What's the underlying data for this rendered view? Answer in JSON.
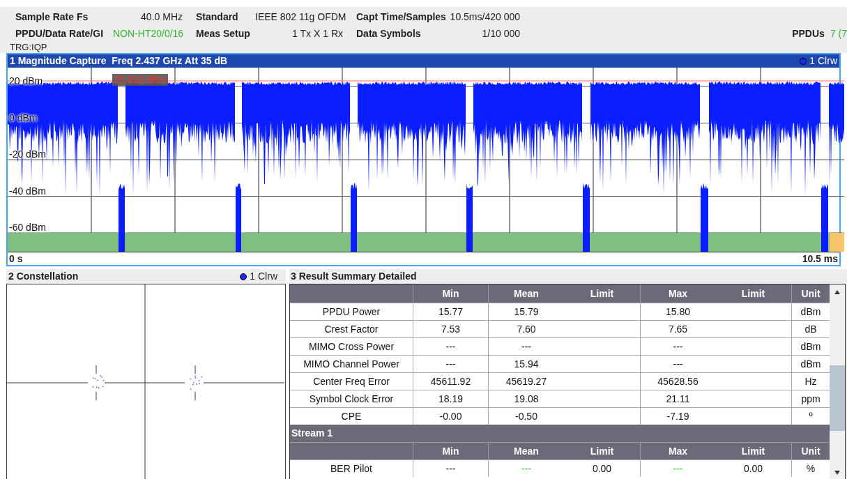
{
  "header": {
    "rows": [
      [
        {
          "label": "Sample Rate Fs",
          "value": "40.0 MHz",
          "highlight": false
        },
        {
          "label": "Standard",
          "value": "IEEE 802 11g OFDM",
          "highlight": false
        },
        {
          "label": "Capt Time/Samples",
          "value": "10.5ms/420 000",
          "highlight": false
        }
      ],
      [
        {
          "label": "PPDU/Data Rate/GI",
          "value": "NON-HT20/0/16",
          "highlight": true
        },
        {
          "label": "Meas Setup",
          "value": "1 Tx X 1 Rx",
          "highlight": false
        },
        {
          "label": "Data Symbols",
          "value": "1/10 000",
          "highlight": false
        }
      ]
    ],
    "ppdus": {
      "label": "PPDUs",
      "value": "7 (7",
      "highlight": true
    },
    "trigger": "TRG:IQP"
  },
  "magnitude": {
    "title": "1 Magnitude Capture  Freq 2.437 GHz Att 35 dB",
    "trace": "1 Clrw",
    "marker": "23.310 dBm",
    "y_labels": [
      "20 dBm",
      "0 dBm",
      "-20 dBm",
      "-40 dBm",
      "-60 dBm"
    ],
    "x_start": "0 s",
    "x_end": "10.5 ms"
  },
  "constellation": {
    "title": "2 Constellation",
    "trace": "1 Clrw"
  },
  "summary": {
    "title": "3 Result Summary Detailed",
    "columns": [
      "",
      "Min",
      "Mean",
      "Limit",
      "Max",
      "Limit",
      "Unit"
    ],
    "rows": [
      {
        "kind": "data",
        "cells": [
          "PPDU Power",
          "15.77",
          "15.79",
          "",
          "15.80",
          "",
          "dBm"
        ],
        "pass": false
      },
      {
        "kind": "data",
        "cells": [
          "Crest Factor",
          "7.53",
          "7.60",
          "",
          "7.65",
          "",
          "dB"
        ],
        "pass": false
      },
      {
        "kind": "data",
        "cells": [
          "MIMO Cross Power",
          "---",
          "---",
          "",
          "---",
          "",
          "dBm"
        ],
        "pass": false
      },
      {
        "kind": "data",
        "cells": [
          "MIMO Channel Power",
          "---",
          "15.94",
          "",
          "---",
          "",
          "dBm"
        ],
        "pass": false
      },
      {
        "kind": "data",
        "cells": [
          "Center Freq Error",
          "45611.92",
          "45619.27",
          "",
          "45628.56",
          "",
          "Hz"
        ],
        "pass": false
      },
      {
        "kind": "data",
        "cells": [
          "Symbol Clock Error",
          "18.19",
          "19.08",
          "",
          "21.11",
          "",
          "ppm"
        ],
        "pass": false
      },
      {
        "kind": "data",
        "cells": [
          "CPE",
          "-0.00",
          "-0.50",
          "",
          "-7.19",
          "",
          "º"
        ],
        "pass": false
      },
      {
        "kind": "section",
        "cells": [
          "Stream 1"
        ]
      },
      {
        "kind": "header",
        "cells": [
          "",
          "Min",
          "Mean",
          "Limit",
          "Max",
          "Limit",
          "Unit"
        ]
      },
      {
        "kind": "data",
        "cells": [
          "BER Pilot",
          "---",
          "---",
          "0.00",
          "---",
          "0.00",
          "%"
        ],
        "pass": true
      }
    ]
  }
}
